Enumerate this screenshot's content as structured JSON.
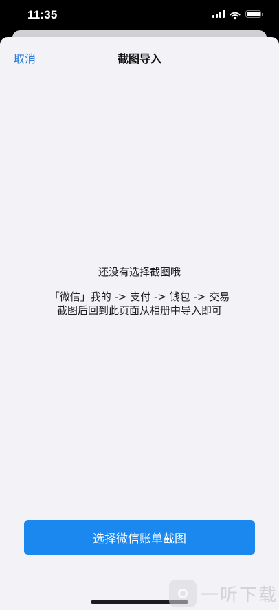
{
  "status_bar": {
    "time": "11:35",
    "signal_icon": "cellular-signal-icon",
    "wifi_icon": "wifi-icon",
    "battery_icon": "battery-icon"
  },
  "nav": {
    "cancel_label": "取消",
    "title": "截图导入"
  },
  "empty_state": {
    "title": "还没有选择截图哦",
    "instruction_line1": "「微信」我的 -> 支付 -> 钱包 -> 交易",
    "instruction_line2": "截图后回到此页面从相册中导入即可"
  },
  "primary_action": {
    "label": "选择微信账单截图"
  },
  "watermark": {
    "text": "一听下载"
  },
  "colors": {
    "accent": "#1a88ef",
    "link": "#2f7fd9",
    "background": "#f2f2f7"
  }
}
